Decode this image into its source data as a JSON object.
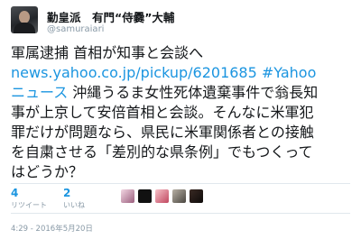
{
  "tweet": {
    "display_name": "勤皇派　有門“侍爨”大輔",
    "handle": "@samuraiari",
    "text_line1": "軍属逮捕 首相が知事と会談へ",
    "link_line2": "news.yahoo.co.jp/pickup/6201685 #Yahoo",
    "link_line3": "ニュース",
    "text_line3": " 沖縄うるま女性死体遺棄事件で翁長知",
    "text_line4": "事が上京して安倍首相と会談。そんなに米軍犯",
    "text_line5": "罪だけが問題なら、県民に米軍関係者との接触",
    "text_line6": "を自粛させる「差別的な県条例」でもつくって",
    "text_line7": "はどうか？",
    "timestamp": "4:29 - 2016年5月20日"
  },
  "stats": {
    "retweets": {
      "count": "4",
      "label": "リツイート"
    },
    "likes": {
      "count": "2",
      "label": "いいね"
    }
  },
  "colors": {
    "link": "#1b95e0",
    "muted": "#8899a6",
    "divider": "#e1e8ed"
  }
}
